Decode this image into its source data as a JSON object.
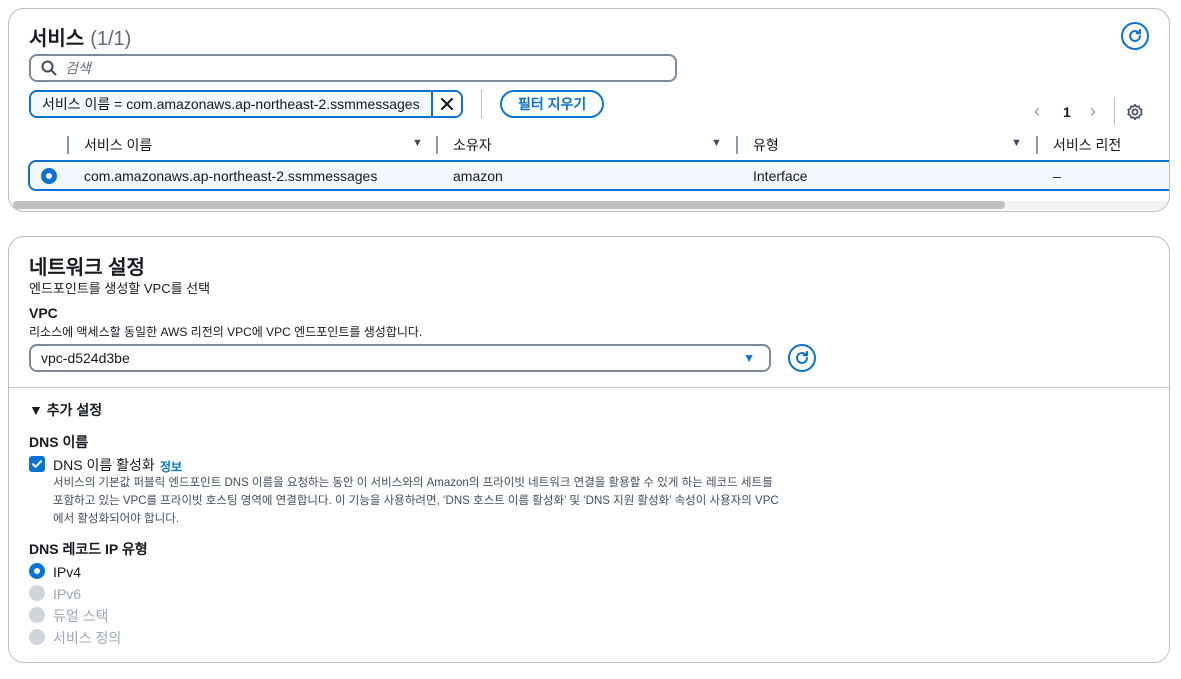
{
  "services": {
    "title": "서비스",
    "count": "(1/1)",
    "search_placeholder": "검색",
    "filter_token": "서비스 이름 = com.amazonaws.ap-northeast-2.ssmmessages",
    "clear_filters_label": "필터 지우기",
    "page_number": "1",
    "columns": [
      "서비스 이름",
      "소유자",
      "유형",
      "서비스 리전"
    ],
    "rows": [
      {
        "service_name": "com.amazonaws.ap-northeast-2.ssmmessages",
        "owner": "amazon",
        "type": "Interface",
        "region": "–",
        "selected": true
      }
    ]
  },
  "network": {
    "title": "네트워크 설정",
    "description": "엔드포인트를 생성할 VPC를 선택",
    "vpc_label": "VPC",
    "vpc_description": "리소스에 액세스할 동일한 AWS 리전의 VPC에 VPC 엔드포인트를 생성합니다.",
    "vpc_value": "vpc-d524d3be",
    "additional_settings": "▼ 추가 설정",
    "dns_name_label": "DNS 이름",
    "dns_enable_label": "DNS 이름 활성화",
    "info_link": "정보",
    "dns_help_line1": "서비스의 기본값 퍼블릭 엔드포인트 DNS 이름을 요청하는 동안 이 서비스와의 Amazon의 프라이빗 네트워크 연결을 활용할 수 있게 하는 레코드 세트를",
    "dns_help_line2": "포함하고 있는 VPC를 프라이빗 호스팅 영역에 연결합니다. 이 기능을 사용하려면, ‘DNS 호스트 이름 활성화’ 및 ‘DNS 지원 활성화’ 속성이 사용자의 VPC",
    "dns_help_line3": "에서 활성화되어야 합니다.",
    "dns_record_ip_label": "DNS 레코드 IP 유형",
    "ip_options": [
      "IPv4",
      "IPv6",
      "듀얼 스택",
      "서비스 정의"
    ]
  },
  "colors": {
    "accent": "#0972d3",
    "border": "#b6bec9",
    "disabled": "#d1d5db"
  }
}
